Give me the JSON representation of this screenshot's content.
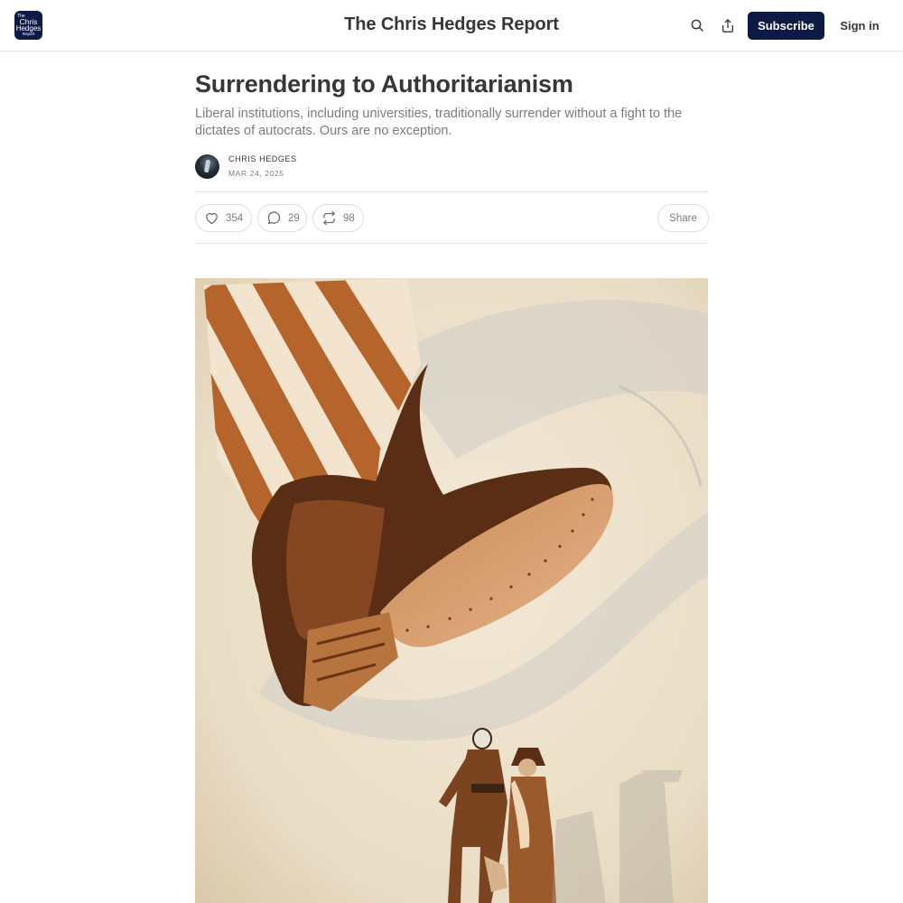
{
  "header": {
    "logo": {
      "line1": "The",
      "line2": "Chris",
      "line3": "Hedges",
      "line4": "Report"
    },
    "publication_title": "The Chris Hedges Report",
    "search_icon": "search-icon",
    "share_icon": "share-icon",
    "subscribe_label": "Subscribe",
    "signin_label": "Sign in"
  },
  "post": {
    "title": "Surrendering to Authoritarianism",
    "subtitle": "Liberal institutions, including universities, traditionally surrender without a fight to the dictates of autocrats. Ours are no exception.",
    "author": "CHRIS HEDGES",
    "date": "MAR 24, 2025",
    "likes": "354",
    "comments": "29",
    "restacks": "98",
    "share_label": "Share"
  },
  "colors": {
    "brand_navy": "#0d1a45",
    "text": "#363737",
    "muted": "#7c7c7c"
  }
}
